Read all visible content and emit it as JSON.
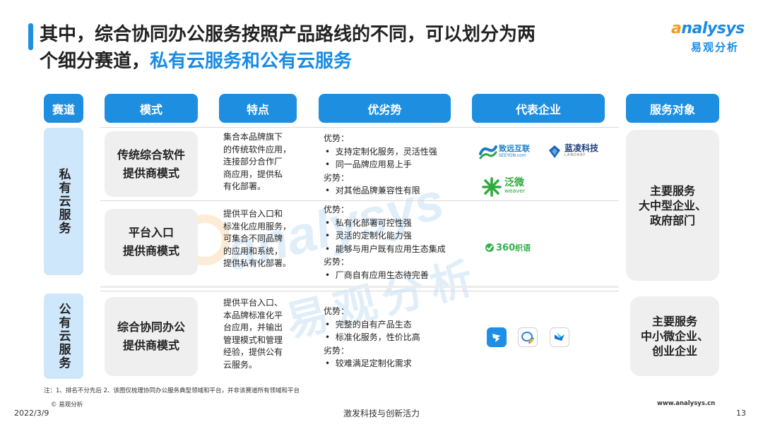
{
  "title": {
    "line1": "其中，综合协同办公服务按照产品路线的不同，可以划分为两",
    "line2_prefix": "个细分赛道，",
    "line2_highlight": "私有云服务和公有云服务"
  },
  "logo": {
    "brand_a": "a",
    "brand_rest": "nalysys",
    "brand_cn": "易观分析"
  },
  "headers": [
    "赛道",
    "模式",
    "特点",
    "优劣势",
    "代表企业",
    "服务对象"
  ],
  "tracks": {
    "private": "私有云服务",
    "public": "公有云服务"
  },
  "rows": [
    {
      "mode": [
        "传统综合软件",
        "提供商模式"
      ],
      "features": [
        "集合本品牌旗下",
        "的传统软件应用，",
        "连接部分合作厂",
        "商应用，提供私",
        "有化部署。"
      ],
      "advantages": [
        {
          "type": "head",
          "text": "优势："
        },
        {
          "type": "item",
          "text": "支持定制化服务，灵活性强"
        },
        {
          "type": "item",
          "text": "同一品牌应用易上手"
        },
        {
          "type": "head",
          "text": "劣势："
        },
        {
          "type": "item",
          "text": "对其他品牌兼容性有限"
        }
      ],
      "enterprises": {
        "seeyon_cn": "致远互联",
        "seeyon_en": "SEEYON.com",
        "landray_cn": "蓝凌科技",
        "landray_en": "LANDRAY",
        "weaver_cn": "泛微",
        "weaver_en": "weaver"
      }
    },
    {
      "mode": [
        "平台入口",
        "提供商模式"
      ],
      "features": [
        "提供平台入口和",
        "标准化应用服务，",
        "可集合不同品牌",
        "的应用和系统，",
        "提供私有化部署。"
      ],
      "advantages": [
        {
          "type": "head",
          "text": "优势："
        },
        {
          "type": "item",
          "text": "私有化部署可控性强"
        },
        {
          "type": "item",
          "text": "灵活的定制化能力强"
        },
        {
          "type": "item",
          "text": "能够与用户既有应用生态集成"
        },
        {
          "type": "head",
          "text": "劣势："
        },
        {
          "type": "item",
          "text": "厂商自有应用生态待完善"
        }
      ],
      "enterprises": {
        "zhiyu_num": "360",
        "zhiyu_cn": "织语"
      }
    },
    {
      "mode": [
        "综合协同办公",
        "提供商模式"
      ],
      "features": [
        "提供平台入口、",
        "本品牌标准化平",
        "台应用，并输出",
        "管理模式和管理",
        "经验，提供公有",
        "云服务。"
      ],
      "advantages": [
        {
          "type": "head",
          "text": "优势："
        },
        {
          "type": "item",
          "text": "完整的自有产品生态"
        },
        {
          "type": "item",
          "text": "标准化服务，性价比高"
        },
        {
          "type": "head",
          "text": "劣势："
        },
        {
          "type": "item",
          "text": "较难满足定制化需求"
        }
      ],
      "enterprises": {}
    }
  ],
  "targets": {
    "private": [
      "主要服务",
      "大中型企业、",
      "政府部门"
    ],
    "public": [
      "主要服务",
      "中小微企业、",
      "创业企业"
    ]
  },
  "watermark": {
    "en": "analysys",
    "cn": "易观分析"
  },
  "footer": {
    "note": "注：1、排名不分先后 2、该图仅梳理协同办公服务典型领域和平台，并非该赛道所有领域和平台",
    "copyright": "© 易观分析",
    "date": "2022/3/9",
    "slogan": "激发科技与创新活力",
    "website": "www.analysys.cn",
    "page": "13"
  },
  "colors": {
    "accent": "#1e8fe0",
    "highlight": "#1a8be3",
    "logo_orange": "#f29b1c",
    "track_bg": "#cfe7fb",
    "cell_bg": "#efefef"
  },
  "icons": [
    "dingtalk-icon",
    "wechat-work-icon",
    "feishu-icon"
  ]
}
